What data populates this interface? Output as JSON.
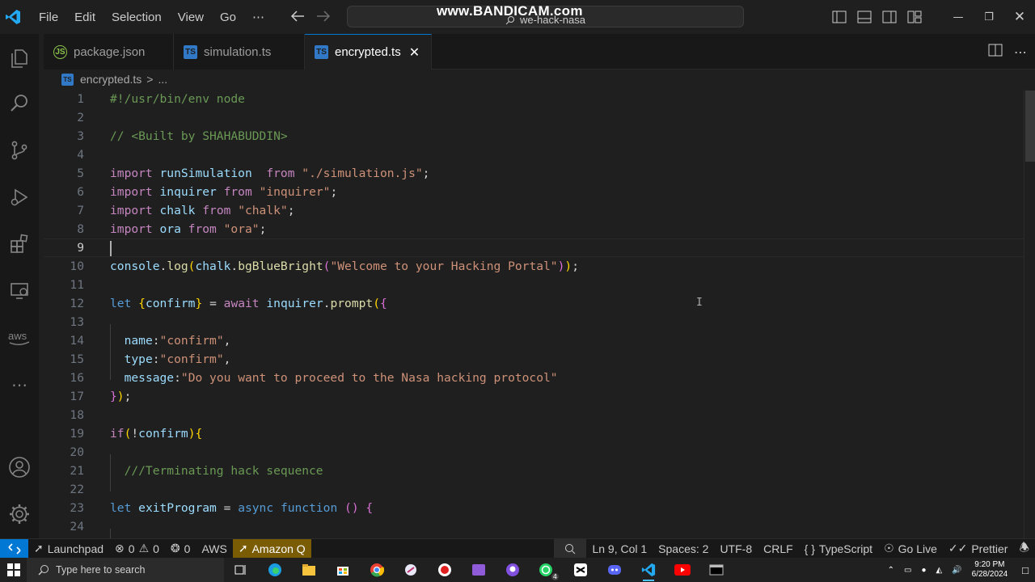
{
  "titlebar": {
    "menu": [
      "File",
      "Edit",
      "Selection",
      "View",
      "Go",
      "⋯"
    ],
    "search": "we-hack-nasa",
    "watermark": "www.BANDICAM.com"
  },
  "tabs": [
    {
      "label": "package.json",
      "icon": "json-file-icon",
      "badge": "JS"
    },
    {
      "label": "simulation.ts",
      "icon": "typescript-file-icon",
      "badge": "TS"
    },
    {
      "label": "encrypted.ts",
      "icon": "typescript-file-icon",
      "badge": "TS",
      "active": true
    }
  ],
  "breadcrumb": {
    "badge": "TS",
    "file": "encrypted.ts",
    "sep": ">",
    "more": "..."
  },
  "editor": {
    "current_line": 9,
    "lines": [
      {
        "n": "1",
        "t": "#!/usr/bin/env node"
      },
      {
        "n": "2",
        "t": ""
      },
      {
        "n": "3",
        "t": "// <Built by SHAHABUDDIN>"
      },
      {
        "n": "4",
        "t": ""
      },
      {
        "n": "5",
        "t": "import runSimulation  from \"./simulation.js\";"
      },
      {
        "n": "6",
        "t": "import inquirer from \"inquirer\";"
      },
      {
        "n": "7",
        "t": "import chalk from \"chalk\";"
      },
      {
        "n": "8",
        "t": "import ora from \"ora\";"
      },
      {
        "n": "9",
        "t": ""
      },
      {
        "n": "10",
        "t": "console.log(chalk.bgBlueBright(\"Welcome to your Hacking Portal\"));"
      },
      {
        "n": "11",
        "t": ""
      },
      {
        "n": "12",
        "t": "let {confirm} = await inquirer.prompt({"
      },
      {
        "n": "13",
        "t": ""
      },
      {
        "n": "14",
        "t": "  name:\"confirm\","
      },
      {
        "n": "15",
        "t": "  type:\"confirm\","
      },
      {
        "n": "16",
        "t": "  message:\"Do you want to proceed to the Nasa hacking protocol\""
      },
      {
        "n": "17",
        "t": "});"
      },
      {
        "n": "18",
        "t": ""
      },
      {
        "n": "19",
        "t": "if(!confirm){"
      },
      {
        "n": "20",
        "t": ""
      },
      {
        "n": "21",
        "t": "  ///Terminating hack sequence"
      },
      {
        "n": "22",
        "t": ""
      },
      {
        "n": "23",
        "t": "let exitProgram = async function () {"
      },
      {
        "n": "24",
        "t": ""
      }
    ]
  },
  "statusbar": {
    "launchpad": "Launchpad",
    "errors": "0",
    "warnings": "0",
    "ports": "0",
    "aws": "AWS",
    "amazon_q": "Amazon Q",
    "position": "Ln 9, Col 1",
    "spaces": "Spaces: 2",
    "encoding": "UTF-8",
    "eol": "CRLF",
    "language": "TypeScript",
    "language_prefix": "{ }",
    "go_live": "Go Live",
    "prettier": "Prettier"
  },
  "taskbar": {
    "search_placeholder": "Type here to search",
    "time": "9:20 PM",
    "date": "6/28/2024",
    "whatsapp_badge": "4"
  },
  "colors": {
    "accent": "#0078d4",
    "amazon_q": "#7a5c05",
    "ts_badge": "#3178c6"
  }
}
